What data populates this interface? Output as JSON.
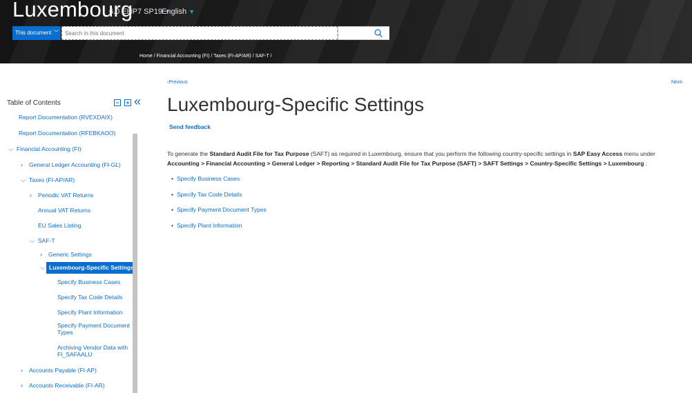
{
  "header": {
    "product": "Luxembourg",
    "version": "6.0 EHP7 SP19",
    "language": "English",
    "scope_label": "This document",
    "search_placeholder": "Search in this document"
  },
  "breadcrumb": "Home / Financial Accounting (FI) / Taxes (FI-AP/AR) / SAF-T /",
  "toc": {
    "title": "Table of Contents",
    "items": [
      {
        "label": "Report Documentation (RVEXDAIX)"
      },
      {
        "label": "Report Documentation (RFEBKAOO)"
      },
      {
        "label": "Financial Accounting (FI)"
      },
      {
        "label": "General Ledger Accounting (FI-GL)"
      },
      {
        "label": "Taxes (FI-AP/AR)"
      },
      {
        "label": "Periodic VAT Returns"
      },
      {
        "label": "Annual VAT Returns"
      },
      {
        "label": "EU Sales Listing"
      },
      {
        "label": "SAF-T"
      },
      {
        "label": "Generic Settings"
      },
      {
        "label": "Luxembourg-Specific Settings"
      },
      {
        "label": "Specify Business Cases"
      },
      {
        "label": "Specify Tax Code Details"
      },
      {
        "label": "Specify Plant Information"
      },
      {
        "label": "Specify Payment Document Types"
      },
      {
        "label": "Archiving Vendor Data with FI_SAFAALU"
      },
      {
        "label": "Accounts Payable (FI-AP)"
      },
      {
        "label": "Accounts Receivable (FI-AR)"
      }
    ]
  },
  "main": {
    "prev": "‹Previous",
    "next": "Next›",
    "title": "Luxembourg-Specific Settings",
    "feedback": "Send feedback",
    "intro": {
      "p1": "To generate the ",
      "b1": "Standard Audit File for Tax Purpose",
      "p2": " (SAFT) as required in Luxembourg, ensure that you perform the following country-specific settings in ",
      "b2": "SAP Easy Access",
      "p3": " menu under",
      "b3": "Accounting > Financial Accounting > General Ledger > Reporting > Standard Audit File for Tax Purpose (SAFT) > SAFT Settings > Country-Specific Settings > Luxembourg",
      "p4": " :"
    },
    "links": [
      "Specify Business Cases",
      "Specify Tax Code Details",
      "Specify Payment Document Types",
      "Specify Plant Information"
    ]
  }
}
